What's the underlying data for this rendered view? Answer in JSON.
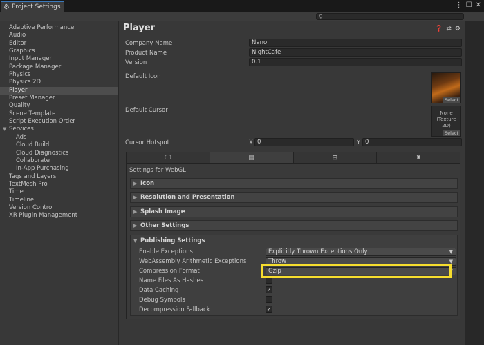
{
  "window": {
    "tab_title": "Project Settings",
    "search": {
      "value": ""
    }
  },
  "sidebar": {
    "items": [
      {
        "label": "Adaptive Performance"
      },
      {
        "label": "Audio"
      },
      {
        "label": "Editor"
      },
      {
        "label": "Graphics"
      },
      {
        "label": "Input Manager"
      },
      {
        "label": "Package Manager"
      },
      {
        "label": "Physics"
      },
      {
        "label": "Physics 2D"
      },
      {
        "label": "Player",
        "selected": true
      },
      {
        "label": "Preset Manager"
      },
      {
        "label": "Quality"
      },
      {
        "label": "Scene Template"
      },
      {
        "label": "Script Execution Order"
      },
      {
        "label": "Services",
        "group": true
      },
      {
        "label": "Ads",
        "sub": true
      },
      {
        "label": "Cloud Build",
        "sub": true
      },
      {
        "label": "Cloud Diagnostics",
        "sub": true
      },
      {
        "label": "Collaborate",
        "sub": true
      },
      {
        "label": "In-App Purchasing",
        "sub": true
      },
      {
        "label": "Tags and Layers"
      },
      {
        "label": "TextMesh Pro"
      },
      {
        "label": "Time"
      },
      {
        "label": "Timeline"
      },
      {
        "label": "Version Control"
      },
      {
        "label": "XR Plugin Management"
      }
    ]
  },
  "inspector": {
    "title": "Player",
    "company_name": {
      "label": "Company Name",
      "value": "Nano"
    },
    "product_name": {
      "label": "Product Name",
      "value": "NightCafe"
    },
    "version": {
      "label": "Version",
      "value": "0.1"
    },
    "default_icon": {
      "label": "Default Icon",
      "select": "Select"
    },
    "default_cursor": {
      "label": "Default Cursor",
      "none_line1": "None",
      "none_line2": "(Texture 2D)",
      "select": "Select"
    },
    "cursor_hotspot": {
      "label": "Cursor Hotspot",
      "x_label": "X",
      "x_value": "0",
      "y_label": "Y",
      "y_value": "0"
    },
    "platform_tabs": [
      {
        "icon": "monitor-icon",
        "active": false
      },
      {
        "icon": "webgl-icon",
        "active": true
      },
      {
        "icon": "windows-icon",
        "active": false
      },
      {
        "icon": "android-icon",
        "active": false
      }
    ],
    "settings_for": "Settings for WebGL",
    "sections": [
      {
        "label": "Icon"
      },
      {
        "label": "Resolution and Presentation"
      },
      {
        "label": "Splash Image"
      },
      {
        "label": "Other Settings"
      }
    ],
    "publishing": {
      "label": "Publishing Settings",
      "enable_exceptions": {
        "label": "Enable Exceptions",
        "value": "Explicitly Thrown Exceptions Only"
      },
      "wasm_arith": {
        "label": "WebAssembly Arithmetic Exceptions",
        "value": "Throw"
      },
      "compression": {
        "label": "Compression Format",
        "value": "Gzip"
      },
      "name_files": {
        "label": "Name Files As Hashes",
        "checked": false
      },
      "data_caching": {
        "label": "Data Caching",
        "checked": true
      },
      "debug_symbols": {
        "label": "Debug Symbols",
        "checked": false
      },
      "decompression_fallback": {
        "label": "Decompression Fallback",
        "checked": true
      }
    }
  },
  "colors": {
    "highlight": "#f6dd2e",
    "tab_accent": "#3a79bb"
  }
}
